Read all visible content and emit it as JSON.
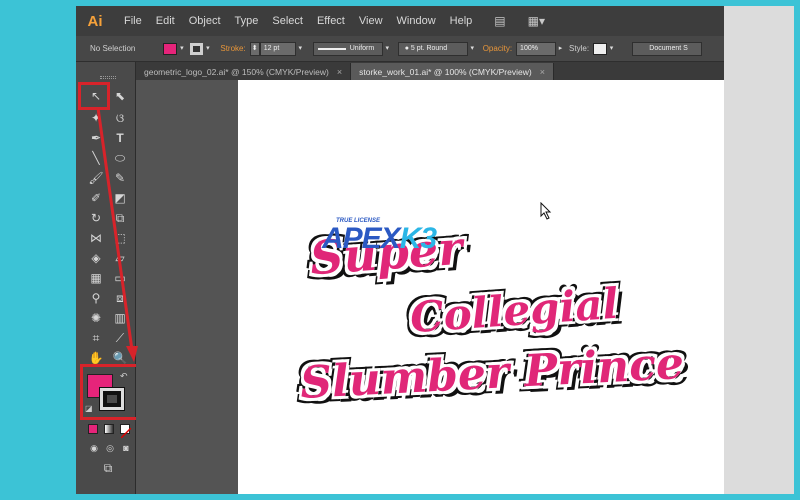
{
  "app": {
    "logo": "Ai"
  },
  "menu": [
    "File",
    "Edit",
    "Object",
    "Type",
    "Select",
    "Effect",
    "View",
    "Window",
    "Help"
  ],
  "control_bar": {
    "selection_label": "No Selection",
    "stroke_label": "Stroke:",
    "stroke_weight": "12 pt",
    "profile": "Uniform",
    "brush": "5 pt. Round",
    "opacity_label": "Opacity:",
    "opacity_value": "100%",
    "style_label": "Style:",
    "doc_setup": "Document S",
    "fill_color": "#e6247a"
  },
  "tabs": [
    {
      "label": "geometric_logo_02.ai* @ 150% (CMYK/Preview)",
      "close": "×",
      "active": false
    },
    {
      "label": "storke_work_01.ai* @ 100% (CMYK/Preview)",
      "close": "×",
      "active": true
    }
  ],
  "artwork": {
    "line1": "Super",
    "line2": "Collegial",
    "line3": "Slumber Prince",
    "fill": "#e02778",
    "outline": "#111111"
  },
  "watermark": {
    "small": "TRUE LICENSE",
    "big_a": "APEX",
    "big_b": "K3"
  },
  "colors": {
    "annotation": "#d8232a",
    "background": "#3cc3d6"
  }
}
